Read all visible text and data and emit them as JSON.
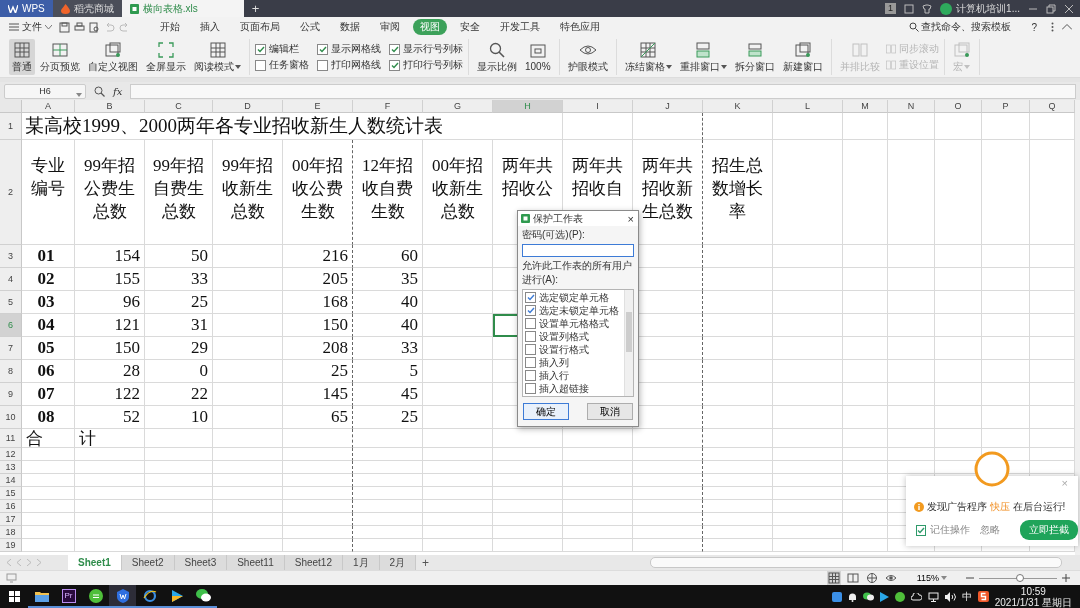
{
  "title_bar": {
    "tabs": [
      {
        "label": "WPS",
        "kind": "home",
        "selected": false
      },
      {
        "label": "稻壳商城",
        "kind": "store",
        "selected": false
      },
      {
        "label": "横向表格.xls",
        "kind": "sheet",
        "selected": true
      }
    ],
    "add_tab": "+",
    "badge": "1",
    "account": "计算机培训1..."
  },
  "menu_bar": {
    "file": "文件",
    "tabs": [
      {
        "label": "开始",
        "selected": false
      },
      {
        "label": "插入",
        "selected": false
      },
      {
        "label": "页面布局",
        "selected": false
      },
      {
        "label": "公式",
        "selected": false
      },
      {
        "label": "数据",
        "selected": false
      },
      {
        "label": "审阅",
        "selected": false
      },
      {
        "label": "视图",
        "selected": true
      },
      {
        "label": "安全",
        "selected": false
      },
      {
        "label": "开发工具",
        "selected": false
      },
      {
        "label": "特色应用",
        "selected": false
      }
    ],
    "search": "查找命令、搜索模板",
    "help": "?"
  },
  "ribbon": {
    "groups": [
      {
        "items": [
          {
            "kind": "large",
            "label": "普通",
            "selected": true,
            "disabled": false,
            "dropdown": false
          },
          {
            "kind": "large",
            "label": "分页预览",
            "selected": false,
            "disabled": false,
            "dropdown": false
          },
          {
            "kind": "large",
            "label": "自定义视图",
            "selected": false,
            "disabled": false,
            "dropdown": false
          },
          {
            "kind": "large",
            "label": "全屏显示",
            "selected": false,
            "disabled": false,
            "dropdown": false
          },
          {
            "kind": "large",
            "label": "阅读模式",
            "selected": false,
            "disabled": false,
            "dropdown": true
          }
        ]
      },
      {
        "items": [
          {
            "kind": "check",
            "label": "编辑栏",
            "checked": true
          },
          {
            "kind": "check",
            "label": "任务窗格",
            "checked": false
          },
          {
            "kind": "check",
            "label": "显示网格线",
            "checked": true
          },
          {
            "kind": "check",
            "label": "打印网格线",
            "checked": false
          },
          {
            "kind": "check",
            "label": "显示行号列标",
            "checked": true
          },
          {
            "kind": "check",
            "label": "打印行号列标",
            "checked": true
          }
        ]
      },
      {
        "items": [
          {
            "kind": "large",
            "label": "显示比例",
            "selected": false,
            "disabled": false,
            "dropdown": false
          },
          {
            "kind": "large",
            "label": "100%",
            "selected": false,
            "disabled": false,
            "dropdown": false
          }
        ]
      },
      {
        "items": [
          {
            "kind": "large",
            "label": "护眼模式",
            "selected": false,
            "disabled": false,
            "dropdown": false
          }
        ]
      },
      {
        "items": [
          {
            "kind": "large",
            "label": "冻结窗格",
            "selected": false,
            "disabled": false,
            "dropdown": true
          },
          {
            "kind": "large",
            "label": "重排窗口",
            "selected": false,
            "disabled": false,
            "dropdown": true
          },
          {
            "kind": "large",
            "label": "拆分窗口",
            "selected": false,
            "disabled": false,
            "dropdown": false
          },
          {
            "kind": "large",
            "label": "新建窗口",
            "selected": false,
            "disabled": false,
            "dropdown": false
          }
        ]
      },
      {
        "items": [
          {
            "kind": "large",
            "label": "并排比较",
            "selected": false,
            "disabled": true,
            "dropdown": false
          },
          {
            "kind": "small",
            "label": "同步滚动",
            "disabled": true
          },
          {
            "kind": "small",
            "label": "重设位置",
            "disabled": true
          }
        ]
      },
      {
        "items": [
          {
            "kind": "large",
            "label": "宏",
            "selected": false,
            "disabled": true,
            "dropdown": true
          }
        ]
      }
    ]
  },
  "formula_bar": {
    "name_box": "H6",
    "fx": "fx"
  },
  "sheet": {
    "columns": [
      {
        "label": "A",
        "selected": false
      },
      {
        "label": "B",
        "selected": false
      },
      {
        "label": "C",
        "selected": false
      },
      {
        "label": "D",
        "selected": false
      },
      {
        "label": "E",
        "selected": false
      },
      {
        "label": "F",
        "selected": false
      },
      {
        "label": "G",
        "selected": false
      },
      {
        "label": "H",
        "selected": true
      },
      {
        "label": "I",
        "selected": false
      },
      {
        "label": "J",
        "selected": false
      },
      {
        "label": "K",
        "selected": false
      },
      {
        "label": "L",
        "selected": false
      },
      {
        "label": "M",
        "selected": false
      },
      {
        "label": "N",
        "selected": false
      },
      {
        "label": "O",
        "selected": false
      },
      {
        "label": "P",
        "selected": false
      },
      {
        "label": "Q",
        "selected": false
      }
    ],
    "rows": [
      {
        "label": "1",
        "kind": "title",
        "selected": false,
        "cells": [
          "某高校1999、2000两年各专业招收新生人数统计表"
        ]
      },
      {
        "label": "2",
        "kind": "header",
        "selected": false,
        "cells": [
          "专业编号",
          "99年招公费生总数",
          "99年招自费生总数",
          "99年招收新生总数",
          "00年招收公费生数",
          "12年招收自费生数",
          "00年招收新生总数",
          "两年共招收公",
          "两年共招收自",
          "两年共招收新生总数",
          "招生总数增长率"
        ]
      },
      {
        "label": "3",
        "kind": "data",
        "selected": false,
        "cells": [
          "01",
          "154",
          "50",
          null,
          "216",
          "60"
        ]
      },
      {
        "label": "4",
        "kind": "data",
        "selected": false,
        "cells": [
          "02",
          "155",
          "33",
          null,
          "205",
          "35"
        ]
      },
      {
        "label": "5",
        "kind": "data",
        "selected": false,
        "cells": [
          "03",
          "96",
          "25",
          null,
          "168",
          "40"
        ]
      },
      {
        "label": "6",
        "kind": "data",
        "selected": true,
        "cells": [
          "04",
          "121",
          "31",
          null,
          "150",
          "40"
        ]
      },
      {
        "label": "7",
        "kind": "data",
        "selected": false,
        "cells": [
          "05",
          "150",
          "29",
          null,
          "208",
          "33"
        ]
      },
      {
        "label": "8",
        "kind": "data",
        "selected": false,
        "cells": [
          "06",
          "28",
          "0",
          null,
          "25",
          "5"
        ]
      },
      {
        "label": "9",
        "kind": "data",
        "selected": false,
        "cells": [
          "07",
          "122",
          "22",
          null,
          "145",
          "45"
        ]
      },
      {
        "label": "10",
        "kind": "data",
        "selected": false,
        "cells": [
          "08",
          "52",
          "10",
          null,
          "65",
          "25"
        ]
      },
      {
        "label": "11",
        "kind": "total",
        "selected": false,
        "cells": [
          "合",
          "计"
        ]
      },
      {
        "label": "12",
        "kind": "empty",
        "selected": false
      },
      {
        "label": "13",
        "kind": "empty",
        "selected": false
      },
      {
        "label": "14",
        "kind": "empty",
        "selected": false
      },
      {
        "label": "15",
        "kind": "empty",
        "selected": false
      },
      {
        "label": "16",
        "kind": "empty",
        "selected": false
      },
      {
        "label": "17",
        "kind": "empty",
        "selected": false
      },
      {
        "label": "18",
        "kind": "empty",
        "selected": false
      },
      {
        "label": "19",
        "kind": "empty",
        "selected": false
      }
    ]
  },
  "sheet_tabs": {
    "tabs": [
      {
        "label": "Sheet1",
        "selected": true
      },
      {
        "label": "Sheet2",
        "selected": false
      },
      {
        "label": "Sheet3",
        "selected": false
      },
      {
        "label": "Sheet11",
        "selected": false
      },
      {
        "label": "Sheet12",
        "selected": false
      },
      {
        "label": "1月",
        "selected": false
      },
      {
        "label": "2月",
        "selected": false
      }
    ],
    "add": "+"
  },
  "status_bar": {
    "views": [
      {
        "kind": "normal",
        "selected": true
      },
      {
        "kind": "page",
        "selected": false
      },
      {
        "kind": "layout",
        "selected": false
      },
      {
        "kind": "eye",
        "selected": false
      }
    ],
    "zoom": "115%",
    "zoom_slider": {
      "level": 0.52
    }
  },
  "dialog": {
    "title": "保护工作表",
    "close": "×",
    "password_label": "密码(可选)(P):",
    "permissions_label": "允许此工作表的所有用户进行(A):",
    "permissions": [
      {
        "label": "选定锁定单元格",
        "checked": true
      },
      {
        "label": "选定未锁定单元格",
        "checked": true
      },
      {
        "label": "设置单元格格式",
        "checked": false
      },
      {
        "label": "设置列格式",
        "checked": false
      },
      {
        "label": "设置行格式",
        "checked": false
      },
      {
        "label": "插入列",
        "checked": false
      },
      {
        "label": "插入行",
        "checked": false
      },
      {
        "label": "插入超链接",
        "checked": false
      }
    ],
    "buttons": [
      {
        "label": "确定",
        "default": true
      },
      {
        "label": "取消",
        "default": false
      }
    ]
  },
  "ad_popup": {
    "close": "×",
    "message_before": "发现广告程序",
    "highlight": "快压",
    "message_after": "在后台运行!",
    "remember": {
      "label": "记住操作",
      "checked": true
    },
    "ignore": "忽略",
    "block": "立即拦截"
  },
  "taskbar": {
    "apps": [
      {
        "kind": "folder",
        "active": false
      },
      {
        "kind": "premiere",
        "label": "Pr",
        "active": false
      },
      {
        "kind": "green",
        "active": false
      },
      {
        "kind": "wps",
        "active": true
      },
      {
        "kind": "browser",
        "active": false
      },
      {
        "kind": "player",
        "active": false
      },
      {
        "kind": "chat",
        "active": false
      }
    ],
    "ime": "中",
    "time": "10:59",
    "date": "2021/1/31 星期日"
  }
}
